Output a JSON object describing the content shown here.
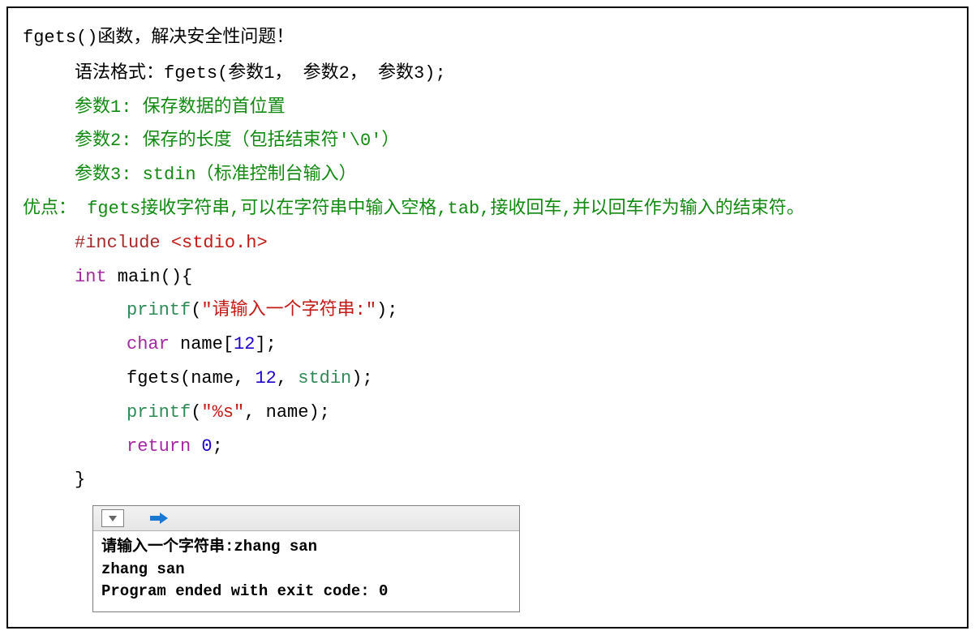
{
  "title_line": {
    "prefix": "fgets()",
    "text": "函数，解决安全性问题！"
  },
  "syntax_line": {
    "label": "语法格式：",
    "code": "fgets(参数1， 参数2， 参数3);"
  },
  "params": [
    "参数1: 保存数据的首位置",
    "参数2: 保存的长度（包括结束符'\\0'）",
    "参数3: stdin（标准控制台输入）"
  ],
  "advantage": {
    "label": "优点：",
    "text": " fgets接收字符串,可以在字符串中输入空格,tab,接收回车,并以回车作为输入的结束符。"
  },
  "code": {
    "l1a": "#include ",
    "l1b": "<stdio.h>",
    "l2a": "int",
    "l2b": " main(){",
    "l3a": "printf",
    "l3b": "(",
    "l3c": "\"请输入一个字符串:\"",
    "l3d": ");",
    "l4a": "char",
    "l4b": " name[",
    "l4c": "12",
    "l4d": "];",
    "l5a": "fgets(name, ",
    "l5b": "12",
    "l5c": ", ",
    "l5d": "stdin",
    "l5e": ");",
    "l6a": "printf",
    "l6b": "(",
    "l6c": "\"%s\"",
    "l6d": ", name);",
    "l7a": "return ",
    "l7b": "0",
    "l7c": ";",
    "l8": "}"
  },
  "console": {
    "lines": [
      "请输入一个字符串:zhang san",
      "zhang san",
      "Program ended with exit code: 0"
    ]
  }
}
